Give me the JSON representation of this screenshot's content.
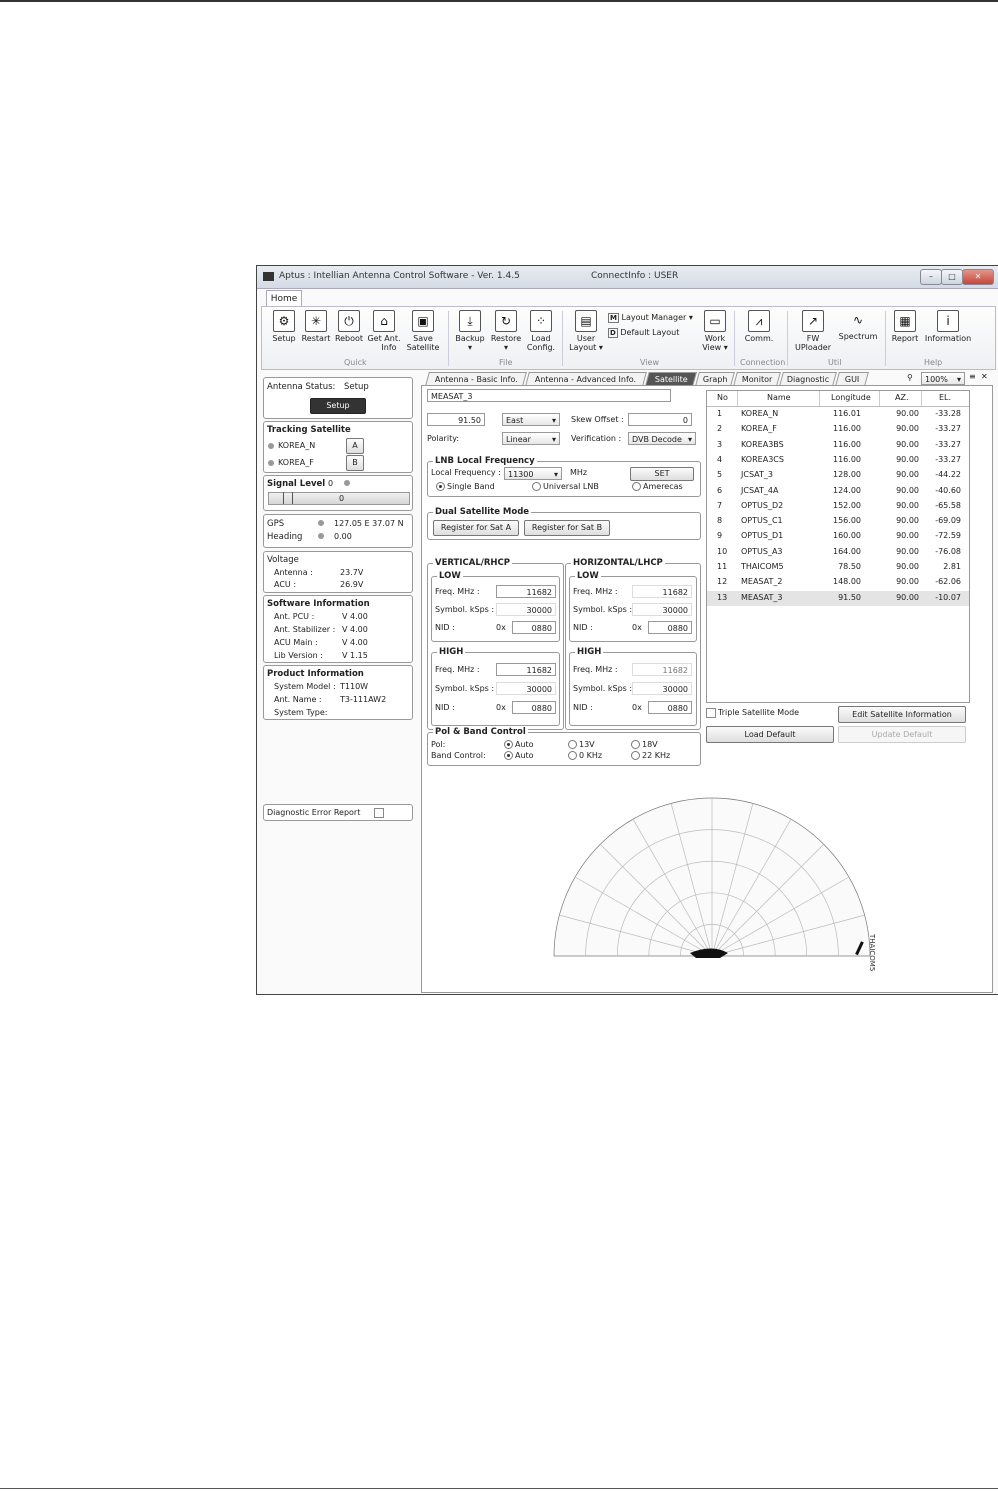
{
  "window": {
    "title": "Aptus : Intellian Antenna Control Software - Ver. 1.4.5",
    "connect_info": "ConnectInfo : USER"
  },
  "ribbon": {
    "tab": "Home",
    "quick": {
      "group": "Quick",
      "setup": "Setup",
      "restart": "Restart",
      "reboot": "Reboot",
      "get_ant_info_1": "Get Ant.",
      "get_ant_info_2": "Info",
      "save_sat_1": "Save",
      "save_sat_2": "Satellite"
    },
    "file": {
      "group": "File",
      "backup": "Backup",
      "restore": "Restore",
      "load_1": "Load",
      "load_2": "Config."
    },
    "view": {
      "group": "View",
      "user_1": "User",
      "user_2": "Layout ▾",
      "layout_manager": "Layout Manager ▾",
      "default_layout": "Default Layout",
      "work_1": "Work",
      "work_2": "View ▾"
    },
    "connection": {
      "group": "Connection",
      "comm": "Comm."
    },
    "util": {
      "group": "Util",
      "fw_1": "FW",
      "fw_2": "UPloader",
      "spectrum": "Spectrum"
    },
    "help": {
      "group": "Help",
      "report": "Report",
      "information": "Information"
    }
  },
  "left": {
    "antenna_status_label": "Antenna Status:",
    "antenna_status_value": "Setup",
    "setup_button": "Setup",
    "tracking_title": "Tracking Satellite",
    "tracking_a": "KOREA_N",
    "tracking_b": "KOREA_F",
    "btn_a": "A",
    "btn_b": "B",
    "signal_title": "Signal Level",
    "signal_value": "0",
    "signal_bar_value": "0",
    "gps_label": "GPS",
    "gps_value": "127.05 E  37.07 N",
    "heading_label": "Heading",
    "heading_value": "0.00",
    "voltage_title": "Voltage",
    "antenna_v_label": "Antenna :",
    "antenna_v_value": "23.7V",
    "acu_v_label": "ACU :",
    "acu_v_value": "26.9V",
    "software_title": "Software Information",
    "sw": [
      {
        "k": "Ant. PCU :",
        "v": "V 4.00"
      },
      {
        "k": "Ant. Stabilizer :",
        "v": "V 4.00"
      },
      {
        "k": "ACU Main :",
        "v": "V 4.00"
      },
      {
        "k": "Lib Version :",
        "v": "V 1.15"
      }
    ],
    "product_title": "Product Information",
    "model_label": "System Model :",
    "model_value": "T110W",
    "ant_name_label": "Ant. Name :",
    "ant_name_value": "T3-111AW2",
    "system_type_label": "System Type:",
    "diag_label": "Diagnostic Error Report"
  },
  "tabs": [
    "Antenna - Basic Info.",
    "Antenna - Advanced Info.",
    "Satellite",
    "Graph",
    "Monitor",
    "Diagnostic",
    "GUI"
  ],
  "zoom": "100%",
  "sat": {
    "name": "MEASAT_3",
    "longitude": "91.50",
    "direction": "East",
    "skew_label": "Skew Offset :",
    "skew_value": "0",
    "polarity_label": "Polarity:",
    "polarity_value": "Linear",
    "verification_label": "Verification :",
    "verification_value": "DVB Decode",
    "lnb_title": "LNB Local Frequency",
    "local_freq_label": "Local Frequency :",
    "local_freq_value": "11300",
    "mhz": "MHz",
    "set": "SET",
    "single_band": "Single Band",
    "universal_lnb": "Universal LNB",
    "amerecas": "Amerecas",
    "dual_title": "Dual Satellite Mode",
    "reg_a": "Register for Sat A",
    "reg_b": "Register for Sat B",
    "vert_title": "VERTICAL/RHCP",
    "horiz_title": "HORIZONTAL/LHCP",
    "low": "LOW",
    "high": "HIGH",
    "freq_label": "Freq. MHz :",
    "sym_label": "Symbol. kSps :",
    "nid_label": "NID :",
    "ox": "0x",
    "v_low": {
      "freq": "11682",
      "sym": "30000",
      "nid": "0880"
    },
    "v_high": {
      "freq": "11682",
      "sym": "30000",
      "nid": "0880"
    },
    "h_low": {
      "freq": "11682",
      "sym": "30000",
      "nid": "0880"
    },
    "h_high": {
      "freq": "11682",
      "sym": "30000",
      "nid": "0880"
    },
    "pol_title": "Pol & Band Control",
    "pol_label": "Pol:",
    "band_label": "Band Control:",
    "auto": "Auto",
    "v13": "13V",
    "v18": "18V",
    "k0": "0 KHz",
    "k22": "22 KHz",
    "triple": "Triple Satellite Mode",
    "edit_info": "Edit Satellite Information",
    "load_default": "Load Default",
    "update_default": "Update Default",
    "radar_label": "THAICOM5"
  },
  "sat_table": {
    "headers": [
      "No",
      "Name",
      "Longitude",
      "AZ.",
      "EL."
    ],
    "rows": [
      [
        "1",
        "KOREA_N",
        "116.01",
        "90.00",
        "-33.28"
      ],
      [
        "2",
        "KOREA_F",
        "116.00",
        "90.00",
        "-33.27"
      ],
      [
        "3",
        "KOREA3BS",
        "116.00",
        "90.00",
        "-33.27"
      ],
      [
        "4",
        "KOREA3CS",
        "116.00",
        "90.00",
        "-33.27"
      ],
      [
        "5",
        "JCSAT_3",
        "128.00",
        "90.00",
        "-44.22"
      ],
      [
        "6",
        "JCSAT_4A",
        "124.00",
        "90.00",
        "-40.60"
      ],
      [
        "7",
        "OPTUS_D2",
        "152.00",
        "90.00",
        "-65.58"
      ],
      [
        "8",
        "OPTUS_C1",
        "156.00",
        "90.00",
        "-69.09"
      ],
      [
        "9",
        "OPTUS_D1",
        "160.00",
        "90.00",
        "-72.59"
      ],
      [
        "10",
        "OPTUS_A3",
        "164.00",
        "90.00",
        "-76.08"
      ],
      [
        "11",
        "THAICOM5",
        "78.50",
        "90.00",
        "2.81"
      ],
      [
        "12",
        "MEASAT_2",
        "148.00",
        "90.00",
        "-62.06"
      ],
      [
        "13",
        "MEASAT_3",
        "91.50",
        "90.00",
        "-10.07"
      ]
    ]
  }
}
